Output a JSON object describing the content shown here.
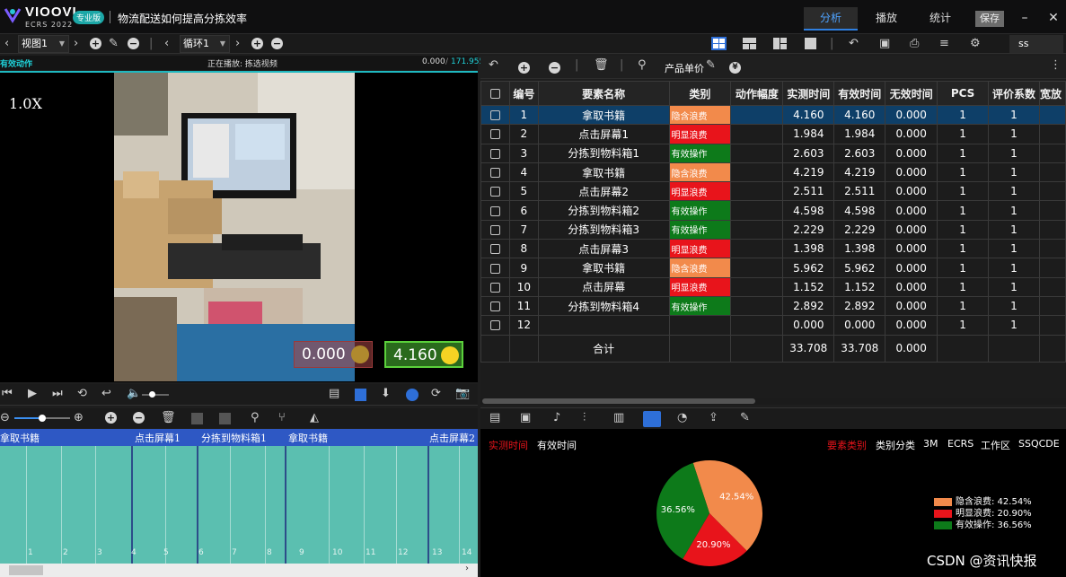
{
  "app": {
    "brand_name": "VIOOVI",
    "brand_sub": "ECRS 2022",
    "edition_badge": "专业版",
    "document_title": "物流配送如何提高分拣效率",
    "top_tabs": [
      "分析",
      "播放",
      "统计"
    ],
    "save_label": "保存",
    "min_label": "–",
    "close_label": "✕"
  },
  "toolbar": {
    "view_select": "视图1",
    "loop_select": "循环1",
    "search_value": "ss"
  },
  "video": {
    "header_left": "有效动作",
    "header_center": "正在播放: 拣选视频",
    "time_current": "0.000",
    "time_total": "171.955",
    "speed": "1.0X",
    "invalid_value": "0.000",
    "valid_value": "4.160"
  },
  "timeline": {
    "labels": [
      "拿取书籍",
      "点击屏幕1",
      "分拣到物料箱1",
      "拿取书籍",
      "点击屏幕2"
    ],
    "ticks": [
      "1",
      "2",
      "3",
      "4",
      "5",
      "6",
      "7",
      "8",
      "9",
      "10",
      "11",
      "12",
      "13",
      "14"
    ]
  },
  "right_toolbar": {
    "unit_price_label": "产品单价"
  },
  "table": {
    "headers": [
      "编号",
      "要素名称",
      "类别",
      "动作幅度",
      "实测时间",
      "有效时间",
      "无效时间",
      "PCS",
      "评价系数",
      "宽放"
    ],
    "category_colors": {
      "隐含浪费": "#f28a4b",
      "明显浪费": "#e8141b",
      "有效操作": "#0d7a1a"
    },
    "rows": [
      {
        "no": "1",
        "name": "拿取书籍",
        "category": "隐含浪费",
        "measured": "4.160",
        "valid": "4.160",
        "invalid": "0.000",
        "pcs": "1",
        "coef": "1"
      },
      {
        "no": "2",
        "name": "点击屏幕1",
        "category": "明显浪费",
        "measured": "1.984",
        "valid": "1.984",
        "invalid": "0.000",
        "pcs": "1",
        "coef": "1"
      },
      {
        "no": "3",
        "name": "分拣到物料箱1",
        "category": "有效操作",
        "measured": "2.603",
        "valid": "2.603",
        "invalid": "0.000",
        "pcs": "1",
        "coef": "1"
      },
      {
        "no": "4",
        "name": "拿取书籍",
        "category": "隐含浪费",
        "measured": "4.219",
        "valid": "4.219",
        "invalid": "0.000",
        "pcs": "1",
        "coef": "1"
      },
      {
        "no": "5",
        "name": "点击屏幕2",
        "category": "明显浪费",
        "measured": "2.511",
        "valid": "2.511",
        "invalid": "0.000",
        "pcs": "1",
        "coef": "1"
      },
      {
        "no": "6",
        "name": "分拣到物料箱2",
        "category": "有效操作",
        "measured": "4.598",
        "valid": "4.598",
        "invalid": "0.000",
        "pcs": "1",
        "coef": "1"
      },
      {
        "no": "7",
        "name": "分拣到物料箱3",
        "category": "有效操作",
        "measured": "2.229",
        "valid": "2.229",
        "invalid": "0.000",
        "pcs": "1",
        "coef": "1"
      },
      {
        "no": "8",
        "name": "点击屏幕3",
        "category": "明显浪费",
        "measured": "1.398",
        "valid": "1.398",
        "invalid": "0.000",
        "pcs": "1",
        "coef": "1"
      },
      {
        "no": "9",
        "name": "拿取书籍",
        "category": "隐含浪费",
        "measured": "5.962",
        "valid": "5.962",
        "invalid": "0.000",
        "pcs": "1",
        "coef": "1"
      },
      {
        "no": "10",
        "name": "点击屏幕",
        "category": "明显浪费",
        "measured": "1.152",
        "valid": "1.152",
        "invalid": "0.000",
        "pcs": "1",
        "coef": "1"
      },
      {
        "no": "11",
        "name": "分拣到物料箱4",
        "category": "有效操作",
        "measured": "2.892",
        "valid": "2.892",
        "invalid": "0.000",
        "pcs": "1",
        "coef": "1"
      },
      {
        "no": "12",
        "name": "",
        "category": "",
        "measured": "0.000",
        "valid": "0.000",
        "invalid": "0.000",
        "pcs": "1",
        "coef": "1"
      }
    ],
    "total": {
      "label": "合计",
      "measured": "33.708",
      "valid": "33.708",
      "invalid": "0.000"
    }
  },
  "chart_panel": {
    "left_tabs": [
      "实测时间",
      "有效时间"
    ],
    "right_tabs": [
      "要素类别",
      "类别分类",
      "3M",
      "ECRS",
      "工作区",
      "SSQCDE"
    ],
    "watermark": "CSDN @资讯快报"
  },
  "chart_data": {
    "type": "pie",
    "slices": [
      {
        "name": "隐含浪费",
        "value": 42.54,
        "label": "42.54%",
        "legend": "隐含浪费: 42.54%",
        "color": "#f28a4b"
      },
      {
        "name": "明显浪费",
        "value": 20.9,
        "label": "20.90%",
        "legend": "明显浪费: 20.90%",
        "color": "#e8141b"
      },
      {
        "name": "有效操作",
        "value": 36.56,
        "label": "36.56%",
        "legend": "有效操作: 36.56%",
        "color": "#0d7a1a"
      }
    ]
  }
}
